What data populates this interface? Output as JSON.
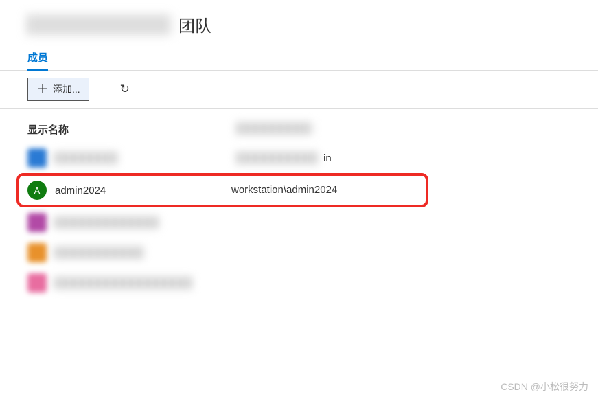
{
  "page": {
    "title_suffix": "团队"
  },
  "tabs": {
    "members": "成员"
  },
  "toolbar": {
    "add_label": "添加...",
    "plus": "＋"
  },
  "columns": {
    "display_name": "显示名称",
    "username_scope": "用户名或范围"
  },
  "members": [
    {
      "avatar_color": "#2a7ad4",
      "name_redacted": true,
      "scope_hint": "in",
      "avatar_shape": "square"
    },
    {
      "avatar_color": "#107c10",
      "avatar_letter": "A",
      "name": "admin2024",
      "scope": "workstation\\admin2024",
      "highlighted": true
    },
    {
      "avatar_color": "#b24aa6",
      "name_redacted": true,
      "avatar_shape": "square"
    },
    {
      "avatar_color": "#e8912b",
      "name_redacted": true,
      "avatar_shape": "square"
    },
    {
      "avatar_color": "#e86da0",
      "name_redacted": true,
      "avatar_shape": "square"
    }
  ],
  "watermark": "CSDN @小松很努力"
}
